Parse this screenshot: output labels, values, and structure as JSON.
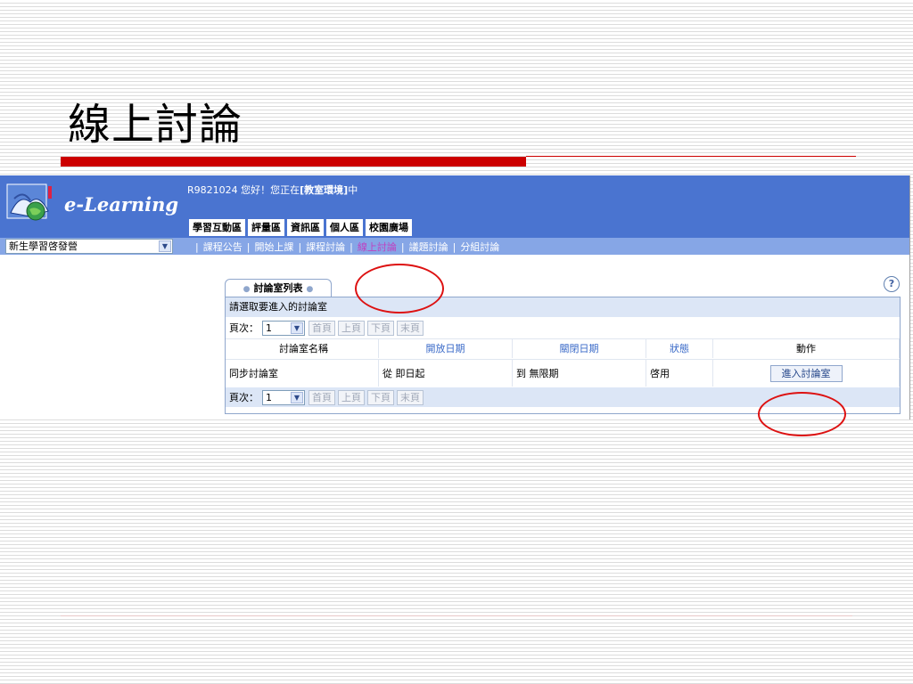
{
  "slide": {
    "title": "線上討論"
  },
  "app": {
    "logo_text": "e-Learning",
    "greeting_prefix": "R9821024 您好！您正在",
    "greeting_location": "[教室環境]",
    "greeting_suffix": "中",
    "main_tabs": [
      "學習互動區",
      "評量區",
      "資訊區",
      "個人區",
      "校園廣場"
    ],
    "course_select_value": "新生學習啓發營",
    "sub_nav": [
      "課程公告",
      "開始上課",
      "課程討論",
      "線上討論",
      "議題討論",
      "分組討論"
    ],
    "active_sub_nav": "線上討論",
    "help_symbol": "?"
  },
  "panel": {
    "tab_label": "討論室列表",
    "prompt": "請選取要進入的討論室",
    "pager": {
      "label": "頁次：",
      "page_value": "1",
      "first": "首頁",
      "prev": "上頁",
      "next": "下頁",
      "last": "末頁"
    },
    "columns": {
      "name": "討論室名稱",
      "open": "開放日期",
      "close": "關閉日期",
      "status": "狀態",
      "action": "動作"
    },
    "rows": [
      {
        "name": "同步討論室",
        "open": "從 即日起",
        "close": "到 無限期",
        "status": "啓用",
        "action": "進入討論室"
      }
    ]
  },
  "colors": {
    "header_blue": "#4a74d0",
    "subnav_blue": "#86a6e6",
    "accent_red": "#cc0000",
    "annotation_red": "#dd1111"
  }
}
